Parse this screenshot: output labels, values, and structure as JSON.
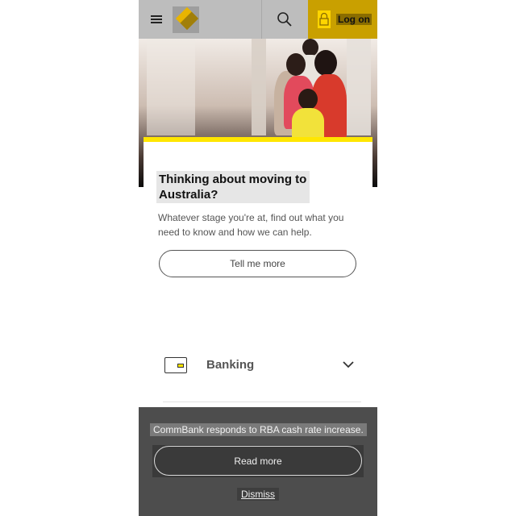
{
  "header": {
    "menu_icon": "hamburger-menu-icon",
    "logo_icon": "diamond-logo-icon",
    "search_icon": "magnifier-search-icon",
    "lock_icon": "padlock-icon",
    "logon_label": "Log on",
    "accent_color": "#ffd500"
  },
  "promo": {
    "title": "Thinking about moving to Australia?",
    "description": "Whatever stage you're at, find out what you need to know and how we can help.",
    "cta_label": "Tell me more"
  },
  "accordion": {
    "items": [
      {
        "label": "Banking",
        "icon": "wallet-icon",
        "expand_icon": "chevron-down-icon"
      }
    ]
  },
  "banner": {
    "message": "CommBank responds to RBA cash rate increase.",
    "read_more_label": "Read more",
    "dismiss_label": "Dismiss",
    "background_color": "#4d4d4d"
  }
}
